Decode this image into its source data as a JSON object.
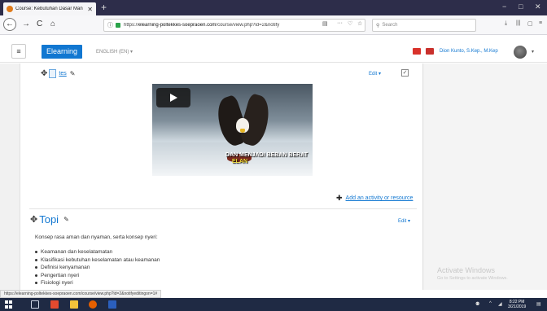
{
  "browser": {
    "tab_title": "Course: Kebutuhan Dasar Man",
    "url_prefix": "https://",
    "url_domain": "elearning-poltekkes-soepraoen.com",
    "url_path": "/course/view.php?id=2&notify",
    "search_placeholder": "Search",
    "new_tab_label": "+",
    "back_label": "←",
    "forward_label": "→",
    "reload_label": "C",
    "home_label": "⌂",
    "reader_label": "▤",
    "more_label": "···",
    "pocket_label": "♡",
    "star_label": "☆",
    "download_label": "⤓",
    "library_label": "|||",
    "sidebar_label": "▢",
    "menu_label": "≡",
    "minimize_label": "−",
    "maximize_label": "□",
    "close_label": "✕"
  },
  "moodle": {
    "brand": "Elearning",
    "language": "ENGLISH (EN) ▾",
    "user_name": "Dion Kunto, S.Kep., M.Kep",
    "menu_icon": "≡",
    "avatar_caret": "▾"
  },
  "section_one": {
    "resource_name": "tes",
    "edit_label": "Edit ▾",
    "check_label": "✓",
    "video_caption_line1": "DAN MENJADI BEBAN BERAT",
    "video_caption_line2": "ELAN",
    "add_activity_label": "Add an activity or resource"
  },
  "section_topi": {
    "title": "Topi",
    "edit_label": "Edit ▾",
    "summary": "Konsep rasa aman dan nyaman, serta konsep nyeri:",
    "items": [
      "Keamanan dan keselatamatan",
      "Klasifikasi kebutuhan keselamatan atau keamanan",
      "Definisi kenyamanan",
      "Pengertian nyeri",
      "Fisiologi nyeri"
    ]
  },
  "status_bar_url": "https://elearning-poltekkes-soepraoen.com/course/view.php?id=2&notifyeditingon=1#",
  "watermark": {
    "title": "Activate Windows",
    "subtitle": "Go to Settings to activate Windows."
  },
  "taskbar": {
    "time": "8:22 PM",
    "date": "3/21/2019"
  },
  "colors": {
    "brand_blue": "#1177d1",
    "tab_bar": "#2d2d4a",
    "taskbar": "#1f2a44"
  }
}
